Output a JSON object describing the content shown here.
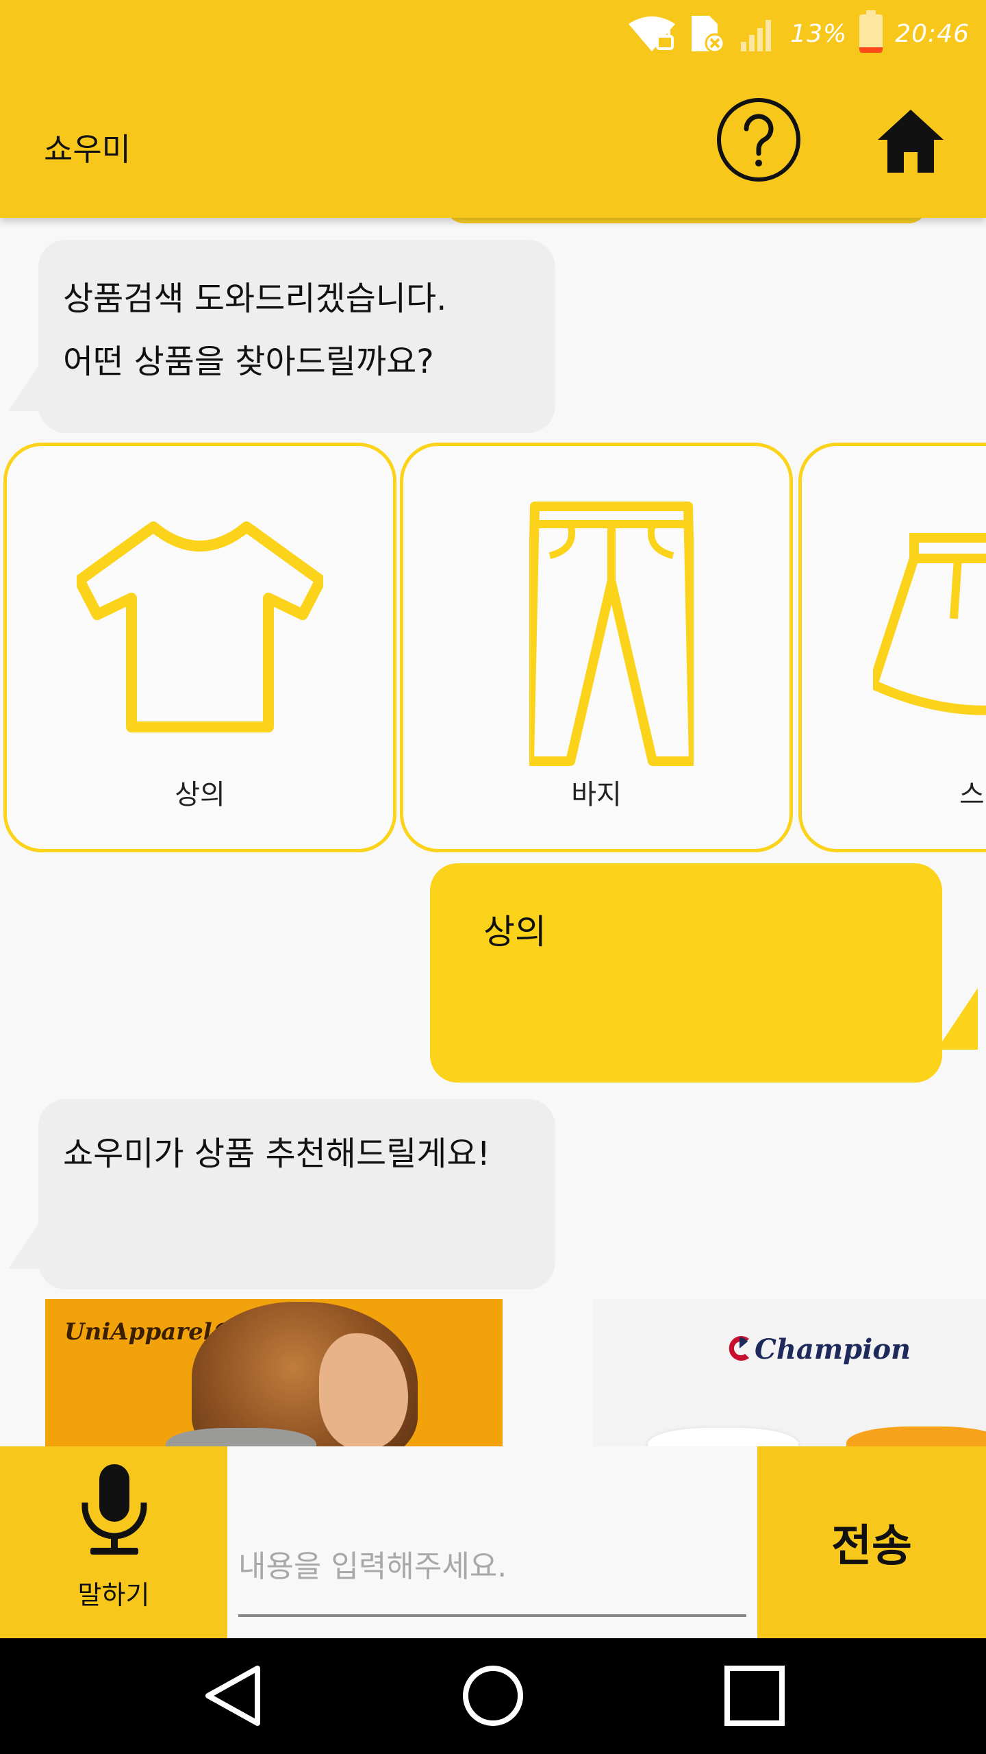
{
  "status_bar": {
    "battery_percent": "13%",
    "time": "20:46"
  },
  "header": {
    "title": "쇼우미",
    "help_icon": "question-circle-icon",
    "home_icon": "home-icon"
  },
  "messages": [
    {
      "sender": "bot",
      "lines": [
        "상품검색 도와드리겠습니다.",
        "어떤 상품을 찾아드릴까요?"
      ]
    },
    {
      "sender": "user",
      "text": "상의"
    },
    {
      "sender": "bot",
      "lines": [
        "쇼우미가 상품 추천해드릴게요!"
      ]
    }
  ],
  "categories": [
    {
      "label": "상의",
      "icon": "tshirt-icon"
    },
    {
      "label": "바지",
      "icon": "pants-icon"
    },
    {
      "label": "스",
      "icon": "skirt-icon"
    }
  ],
  "products": [
    {
      "brand": "UniApparel®"
    },
    {
      "brand": "Champion"
    }
  ],
  "input_bar": {
    "mic_label": "말하기",
    "placeholder": "내용을 입력해주세요.",
    "send_label": "전송"
  },
  "colors": {
    "accent": "#f7c81b",
    "user_bubble": "#fcd31b",
    "bot_bubble": "#eeeeee"
  }
}
